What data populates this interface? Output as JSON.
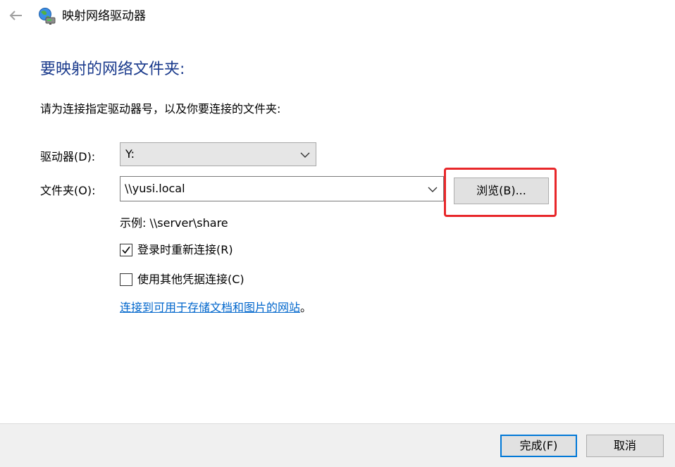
{
  "window": {
    "title": "映射网络驱动器",
    "back_icon": "back-arrow-icon",
    "app_icon": "network-drive-icon"
  },
  "content": {
    "heading": "要映射的网络文件夹:",
    "instruction": "请为连接指定驱动器号，以及你要连接的文件夹:",
    "drive": {
      "label": "驱动器(D):",
      "value": "Y:"
    },
    "folder": {
      "label": "文件夹(O):",
      "value": "\\\\yusi.local"
    },
    "browse_label": "浏览(B)...",
    "example": "示例: \\\\server\\share",
    "reconnect": {
      "label": "登录时重新连接(R)",
      "checked": true
    },
    "credentials": {
      "label": "使用其他凭据连接(C)",
      "checked": false
    },
    "link_text": "连接到可用于存储文档和图片的网站",
    "link_suffix": "。"
  },
  "footer": {
    "finish_label": "完成(F)",
    "cancel_label": "取消"
  },
  "colors": {
    "heading": "#1a3a8c",
    "link": "#0066cc",
    "highlight": "#e8272a",
    "default_button_border": "#0078d7"
  }
}
